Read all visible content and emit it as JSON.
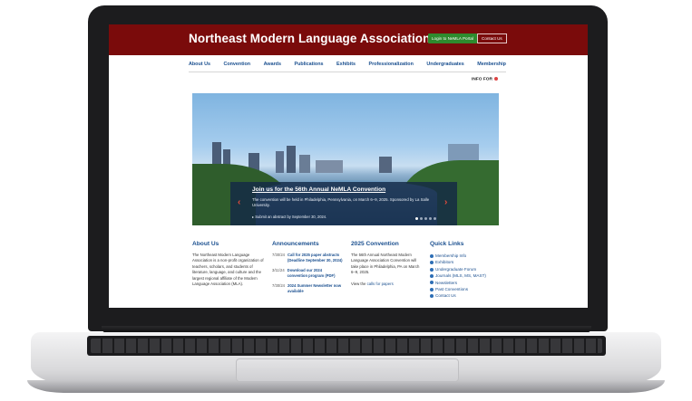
{
  "header": {
    "title": "Northeast Modern Language Association",
    "portal_button": "Login to NeMLA Portal",
    "contact_button": "Contact Us"
  },
  "nav": {
    "items": [
      "About Us",
      "Convention",
      "Awards",
      "Publications",
      "Exhibits",
      "Professionalization",
      "Undergraduates",
      "Membership"
    ]
  },
  "info_for": "INFO FOR",
  "hero": {
    "title": "Join us for the 56th Annual NeMLA Convention",
    "body": "The convention will be held in Philadelphia, Pennsylvania, on March 6–9, 2025. Sponsored by La Salle University.",
    "note": "▸ Submit an abstract by September 30, 2024.",
    "prev": "‹",
    "next": "›"
  },
  "about": {
    "heading": "About Us",
    "text": "The Northeast Modern Language Association is a non-profit organization of teachers, scholars, and students of literature, language, and culture and the largest regional affiliate of the Modern Language Association (MLA)."
  },
  "announcements": {
    "heading": "Announcements",
    "items": [
      {
        "date": "7/30/24",
        "title": "Call for 2025 paper abstracts (Deadline September 30, 2024)"
      },
      {
        "date": "3/11/24",
        "title": "Download our 2024 convention program (PDF)"
      },
      {
        "date": "7/30/24",
        "title": "2024 Summer Newsletter now available"
      }
    ]
  },
  "convention": {
    "heading": "2025 Convention",
    "text": "The 56th Annual Northeast Modern Language Association Convention will take place in Philadelphia, PA on March 6–9, 2025.",
    "view_prefix": "View the",
    "view_link": "calls for papers"
  },
  "quick_links": {
    "heading": "Quick Links",
    "items": [
      "Membership Info",
      "Exhibitors",
      "Undergraduate Forum",
      "Journals (MLS, MS, MAST)",
      "Newsletters",
      "Past Conventions",
      "Contact Us"
    ]
  },
  "colors": {
    "header_bg": "#7a0b0b",
    "accent_blue": "#1a4f8f",
    "portal_green": "#2e8b2e",
    "arrow_red": "#e84b3c"
  }
}
